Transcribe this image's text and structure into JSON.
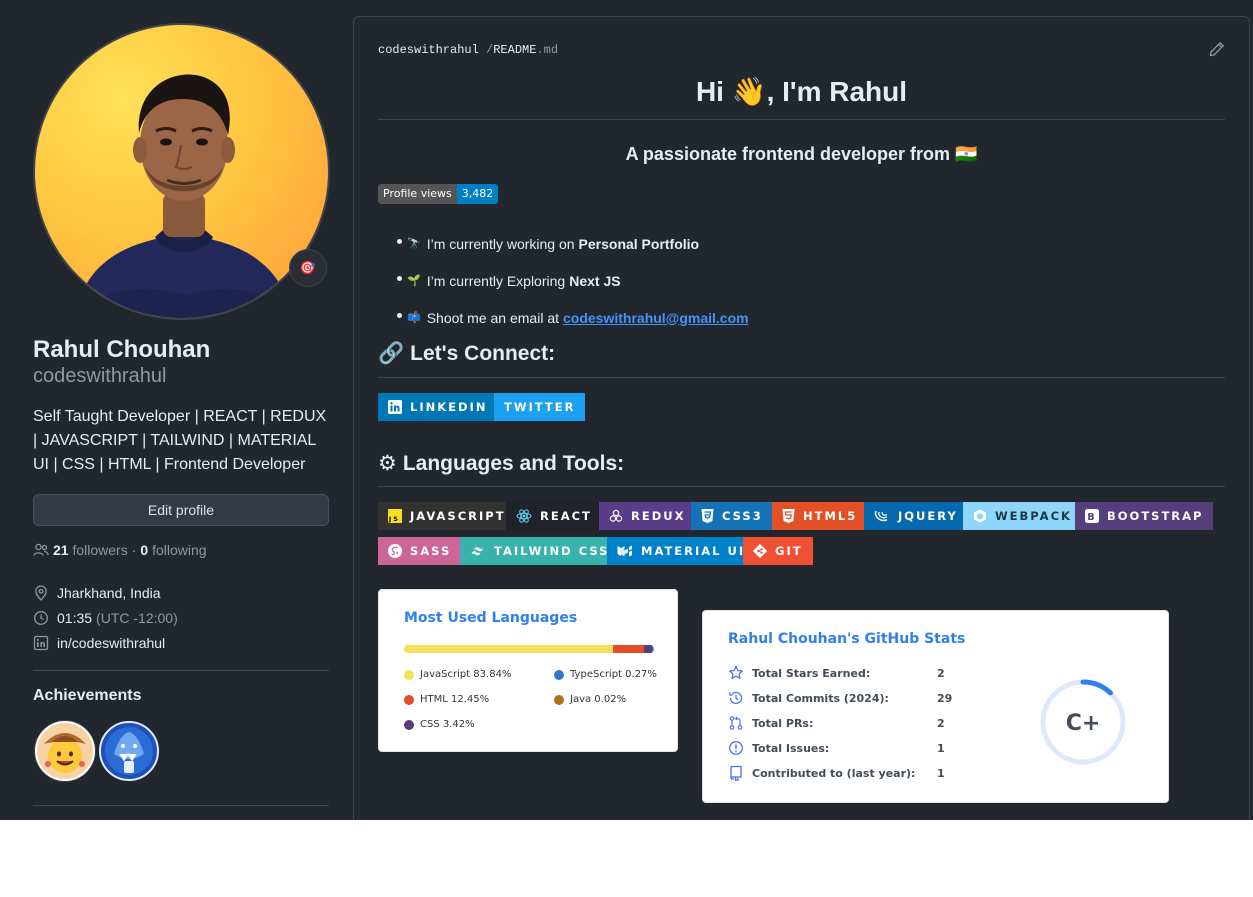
{
  "profile": {
    "name": "Rahul Chouhan",
    "login": "codeswithrahul",
    "bio": "Self Taught Developer | REACT | REDUX | JAVASCRIPT | TAILWIND | MATERIAL UI | CSS | HTML | Frontend Developer",
    "status_emoji": "🎯",
    "edit_label": "Edit profile",
    "followers_count": "21",
    "followers_label": "followers",
    "following_count": "0",
    "following_label": "following",
    "location": "Jharkhand, India",
    "time": "01:35",
    "timezone": "(UTC -12:00)",
    "linkedin": "in/codeswithrahul",
    "achievements_title": "Achievements"
  },
  "readme": {
    "path_owner": "codeswithrahul",
    "path_sep": "/",
    "path_file": "README",
    "path_ext": ".md",
    "heading": "Hi 👋, I'm Rahul",
    "subheading": "A passionate frontend developer from 🇮🇳",
    "views_label": "Profile views",
    "views_count": "3,482",
    "bullets": [
      {
        "emoji": "🔭",
        "text": "I’m currently working on",
        "strong": "Personal Portfolio"
      },
      {
        "emoji": "🌱",
        "text": "I’m currently Exploring",
        "strong": "Next JS"
      },
      {
        "emoji": "📫",
        "text": "Shoot me an email at",
        "link": "codeswithrahul@gmail.com"
      }
    ],
    "connect_emoji": "🔗",
    "connect_title": "Let's Connect:",
    "social": [
      {
        "label": "LINKEDIN",
        "color": "#0077b5",
        "icon": "linkedin-icon"
      },
      {
        "label": "TWITTER",
        "color": "#1ca0f2",
        "icon": "twitter-icon"
      }
    ],
    "tools_emoji": "⚙",
    "tools_title": "Languages and Tools:",
    "tools": [
      {
        "label": "JAVASCRIPT",
        "color": "#323330",
        "icon": "javascript-icon"
      },
      {
        "label": "REACT",
        "color": "#20232a",
        "icon": "react-icon"
      },
      {
        "label": "REDUX",
        "color": "#593d88",
        "icon": "redux-icon"
      },
      {
        "label": "CSS3",
        "color": "#1572b6",
        "icon": "css3-icon"
      },
      {
        "label": "HTML5",
        "color": "#e34f26",
        "icon": "html5-icon"
      },
      {
        "label": "JQUERY",
        "color": "#0769ad",
        "icon": "jquery-icon"
      },
      {
        "label": "WEBPACK",
        "color": "#8dd6f9",
        "icon": "webpack-icon"
      },
      {
        "label": "BOOTSTRAP",
        "color": "#563d7c",
        "icon": "bootstrap-icon"
      },
      {
        "label": "SASS",
        "color": "#cc6699",
        "icon": "sass-icon"
      },
      {
        "label": "TAILWIND CSS",
        "color": "#38b2ac",
        "icon": "tailwind-icon"
      },
      {
        "label": "MATERIAL UI",
        "color": "#0081cb",
        "icon": "material-ui-icon"
      },
      {
        "label": "GIT",
        "color": "#f05033",
        "icon": "git-icon"
      }
    ]
  },
  "languages_card": {
    "title": "Most Used Languages",
    "items": [
      {
        "name": "JavaScript",
        "percent": 83.84,
        "label": "JavaScript 83.84%",
        "color": "#f1e05a"
      },
      {
        "name": "HTML",
        "percent": 12.45,
        "label": "HTML 12.45%",
        "color": "#e34c26"
      },
      {
        "name": "CSS",
        "percent": 3.42,
        "label": "CSS 3.42%",
        "color": "#563d7c"
      },
      {
        "name": "TypeScript",
        "percent": 0.27,
        "label": "TypeScript 0.27%",
        "color": "#3178c6"
      },
      {
        "name": "Java",
        "percent": 0.02,
        "label": "Java 0.02%",
        "color": "#b07219"
      }
    ]
  },
  "stats_card": {
    "title": "Rahul Chouhan's GitHub Stats",
    "rows": [
      {
        "label": "Total Stars Earned:",
        "value": "2",
        "icon": "star-icon"
      },
      {
        "label": "Total Commits (2024):",
        "value": "29",
        "icon": "history-icon"
      },
      {
        "label": "Total PRs:",
        "value": "2",
        "icon": "pull-request-icon"
      },
      {
        "label": "Total Issues:",
        "value": "1",
        "icon": "issue-icon"
      },
      {
        "label": "Contributed to (last year):",
        "value": "1",
        "icon": "repo-icon"
      }
    ],
    "rank": "C+",
    "rank_progress": 0.12,
    "ring_color": "#2f80ed"
  }
}
